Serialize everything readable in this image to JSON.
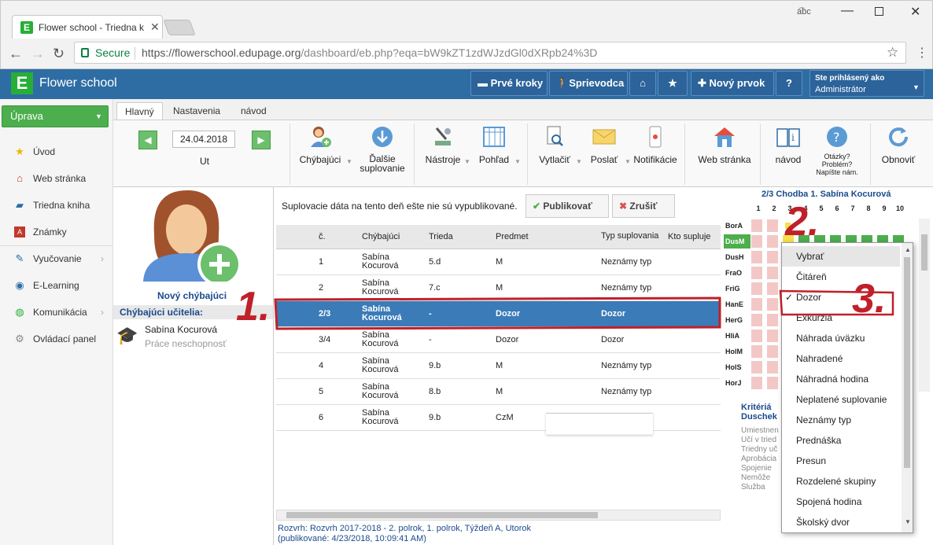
{
  "browser": {
    "tab_title": "Flower school - Triedna k",
    "secure": "Secure",
    "url_host": "https://flowerschool.edupage.org",
    "url_path": "/dashboard/eb.php?eqa=bW9kZT1zdWJzdGl0dXRpb24%3D"
  },
  "header": {
    "app_name": "Flower school",
    "btn_first_steps": "Prvé kroky",
    "btn_guide": "Sprievodca",
    "btn_new": "Nový prvok",
    "btn_help": "?",
    "user_line1": "Ste prihlásený ako",
    "user_line2": "Administrátor"
  },
  "sidebar": {
    "uprava": "Úprava",
    "items": [
      "Úvod",
      "Web stránka",
      "Triedna kniha",
      "Známky",
      "Vyučovanie",
      "E-Learning",
      "Komunikácia",
      "Ovládací panel"
    ]
  },
  "ribbon": {
    "tabs": [
      "Hlavný",
      "Nastavenia",
      "návod"
    ],
    "date": "24.04.2018",
    "day": "Ut",
    "chybajuci": "Chýbajúci",
    "dalsie1": "Ďalšie",
    "dalsie2": "suplovanie",
    "nastroje": "Nástroje",
    "pohlad": "Pohľad",
    "vytlacit": "Vytlačiť",
    "poslat": "Poslať",
    "notifikacie": "Notifikácie",
    "web": "Web stránka",
    "navod": "návod",
    "otazky1": "Otázky?",
    "otazky2": "Problém?",
    "otazky3": "Napíšte nám.",
    "obnovit": "Obnoviť"
  },
  "left": {
    "new_absent": "Nový chýbajúci",
    "absent_header": "Chýbajúci učitelia:",
    "teacher_name": "Sabína Kocurová",
    "teacher_reason": "Práce neschopnosť"
  },
  "center": {
    "notice": "Suplovacie dáta na tento deň ešte nie sú vypublikované.",
    "publish": "Publikovať",
    "cancel": "Zrušiť",
    "columns": [
      "č.",
      "Chýbajúci",
      "Trieda",
      "Predmet",
      "Typ suplovania",
      "Kto supluje"
    ],
    "rows": [
      [
        "1",
        "Sabína Kocurová",
        "5.d",
        "M",
        "Neznámy typ"
      ],
      [
        "2",
        "Sabína Kocurová",
        "7.c",
        "M",
        "Neznámy typ"
      ],
      [
        "2/3",
        "Sabína Kocurová",
        "-",
        "Dozor",
        "Dozor"
      ],
      [
        "3/4",
        "Sabína Kocurová",
        "-",
        "Dozor",
        "Dozor"
      ],
      [
        "4",
        "Sabína Kocurová",
        "9.b",
        "M",
        "Neznámy typ"
      ],
      [
        "5",
        "Sabína Kocurová",
        "8.b",
        "M",
        "Neznámy typ"
      ],
      [
        "6",
        "Sabína Kocurová",
        "9.b",
        "CzM",
        ""
      ]
    ],
    "footer1": "Rozvrh: Rozvrh 2017-2018 - 2. polrok, 1. polrok, Týždeň A, Utorok",
    "footer2": "(publikované: 4/23/2018, 10:09:41 AM)"
  },
  "right": {
    "title": "2/3 Chodba 1. Sabína Kocurová",
    "cols": [
      "1",
      "2",
      "3",
      "4",
      "5",
      "6",
      "7",
      "8",
      "9",
      "10"
    ],
    "rows": [
      "BorA",
      "DusM",
      "DusH",
      "FraO",
      "FriG",
      "HanE",
      "HerG",
      "HliA",
      "HolM",
      "HolS",
      "HorJ"
    ],
    "criteria_title": "Kritériá",
    "criteria_name": "Duschek",
    "criteria": [
      "Umiestnen",
      "Učí v tried",
      "Triedny uč",
      "Aprobácia",
      "Spojenie",
      "Nemôže",
      "Služba"
    ]
  },
  "dropdown": {
    "items": [
      "Vybrať",
      "Čitáreň",
      "Dozor",
      "Exkurzia",
      "Náhrada úväzku",
      "Nahradené",
      "Náhradná hodina",
      "Neplatené suplovanie",
      "Neznámy typ",
      "Prednáška",
      "Presun",
      "Rozdelené skupiny",
      "Spojená hodina",
      "Školský dvor"
    ],
    "checked": "✓"
  },
  "annotations": [
    "1.",
    "2.",
    "3."
  ]
}
